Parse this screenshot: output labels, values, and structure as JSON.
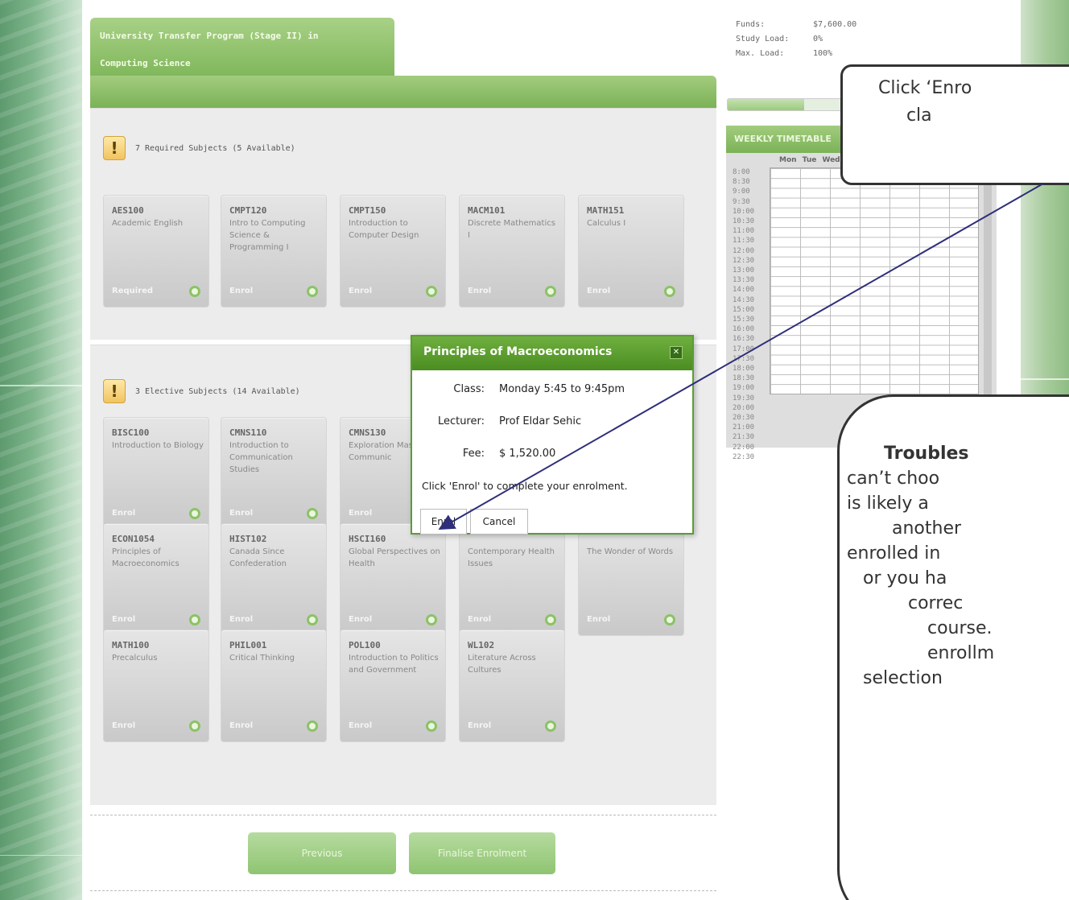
{
  "program": {
    "title_line1": "University Transfer Program (Stage II) in",
    "title_line2": "Computing Science"
  },
  "required": {
    "title": "7 Required Subjects (5 Available)",
    "cards": [
      {
        "code": "AES100",
        "name": "Academic English",
        "action": "Required"
      },
      {
        "code": "CMPT120",
        "name": "Intro to Computing Science & Programming I",
        "action": "Enrol"
      },
      {
        "code": "CMPT150",
        "name": "Introduction to Computer Design",
        "action": "Enrol"
      },
      {
        "code": "MACM101",
        "name": "Discrete Mathematics I",
        "action": "Enrol"
      },
      {
        "code": "MATH151",
        "name": "Calculus I",
        "action": "Enrol"
      }
    ]
  },
  "elective": {
    "title": "3 Elective Subjects (14 Available)",
    "cards": [
      {
        "code": "BISC100",
        "name": "Introduction to Biology",
        "action": "Enrol"
      },
      {
        "code": "CMNS110",
        "name": "Introduction to Communication Studies",
        "action": "Enrol"
      },
      {
        "code": "CMNS130",
        "name": "Exploration Mass Communic",
        "action": "Enrol"
      },
      {
        "code": "ECON1054",
        "name": "Principles of Macroeconomics",
        "action": "Enrol"
      },
      {
        "code": "HIST102",
        "name": "Canada Since Confederation",
        "action": "Enrol"
      },
      {
        "code": "HSCI160",
        "name": "Global Perspectives on Health",
        "action": "Enrol"
      },
      {
        "code": "",
        "name": "Contemporary Health Issues",
        "action": "Enrol"
      },
      {
        "code": "",
        "name": "The Wonder of Words",
        "action": "Enrol"
      },
      {
        "code": "MATH100",
        "name": "Precalculus",
        "action": "Enrol"
      },
      {
        "code": "PHIL001",
        "name": "Critical Thinking",
        "action": "Enrol"
      },
      {
        "code": "POL100",
        "name": "Introduction to Politics and Government",
        "action": "Enrol"
      },
      {
        "code": "WL102",
        "name": "Literature Across Cultures",
        "action": "Enrol"
      }
    ]
  },
  "buttons": {
    "previous": "Previous",
    "finalise": "Finalise Enrolment"
  },
  "funds": {
    "funds_label": "Funds:",
    "funds_value": "$7,600.00",
    "load_label": "Study Load:",
    "load_value": "0%",
    "max_label": "Max. Load:",
    "max_value": "100%"
  },
  "timetable": {
    "title": "WEEKLY TIMETABLE",
    "days": "Mon Tue Wed",
    "times": [
      "8:00",
      "8:30",
      "9:00",
      "9:30",
      "10:00",
      "10:30",
      "11:00",
      "11:30",
      "12:00",
      "12:30",
      "13:00",
      "13:30",
      "14:00",
      "14:30",
      "15:00",
      "15:30",
      "16:00",
      "16:30",
      "17:00",
      "17:30",
      "18:00",
      "18:30",
      "19:00",
      "19:30",
      "20:00",
      "20:30",
      "21:00",
      "21:30",
      "22:00",
      "22:30"
    ]
  },
  "modal": {
    "title": "Principles of Macroeconomics",
    "class_label": "Class:",
    "class_value": "Monday  5:45 to 9:45pm",
    "lecturer_label": "Lecturer:",
    "lecturer_value": "Prof Eldar Sehic",
    "fee_label": "Fee:",
    "fee_value": "$ 1,520.00",
    "message": "Click 'Enrol' to complete your enrolment.",
    "enrol": "Enrol",
    "cancel": "Cancel"
  },
  "callouts": {
    "top": "Click ‘Enro\n     cla",
    "bottom_bold": "Troubles",
    "bottom_lines": [
      "can’t choo",
      "is likely a",
      "another",
      "enrolled in",
      "or you ha",
      "correc",
      "course.",
      "enrollm",
      "selection"
    ]
  },
  "colors": {
    "accent_green": "#7bb257",
    "modal_green": "#4c8d22"
  }
}
